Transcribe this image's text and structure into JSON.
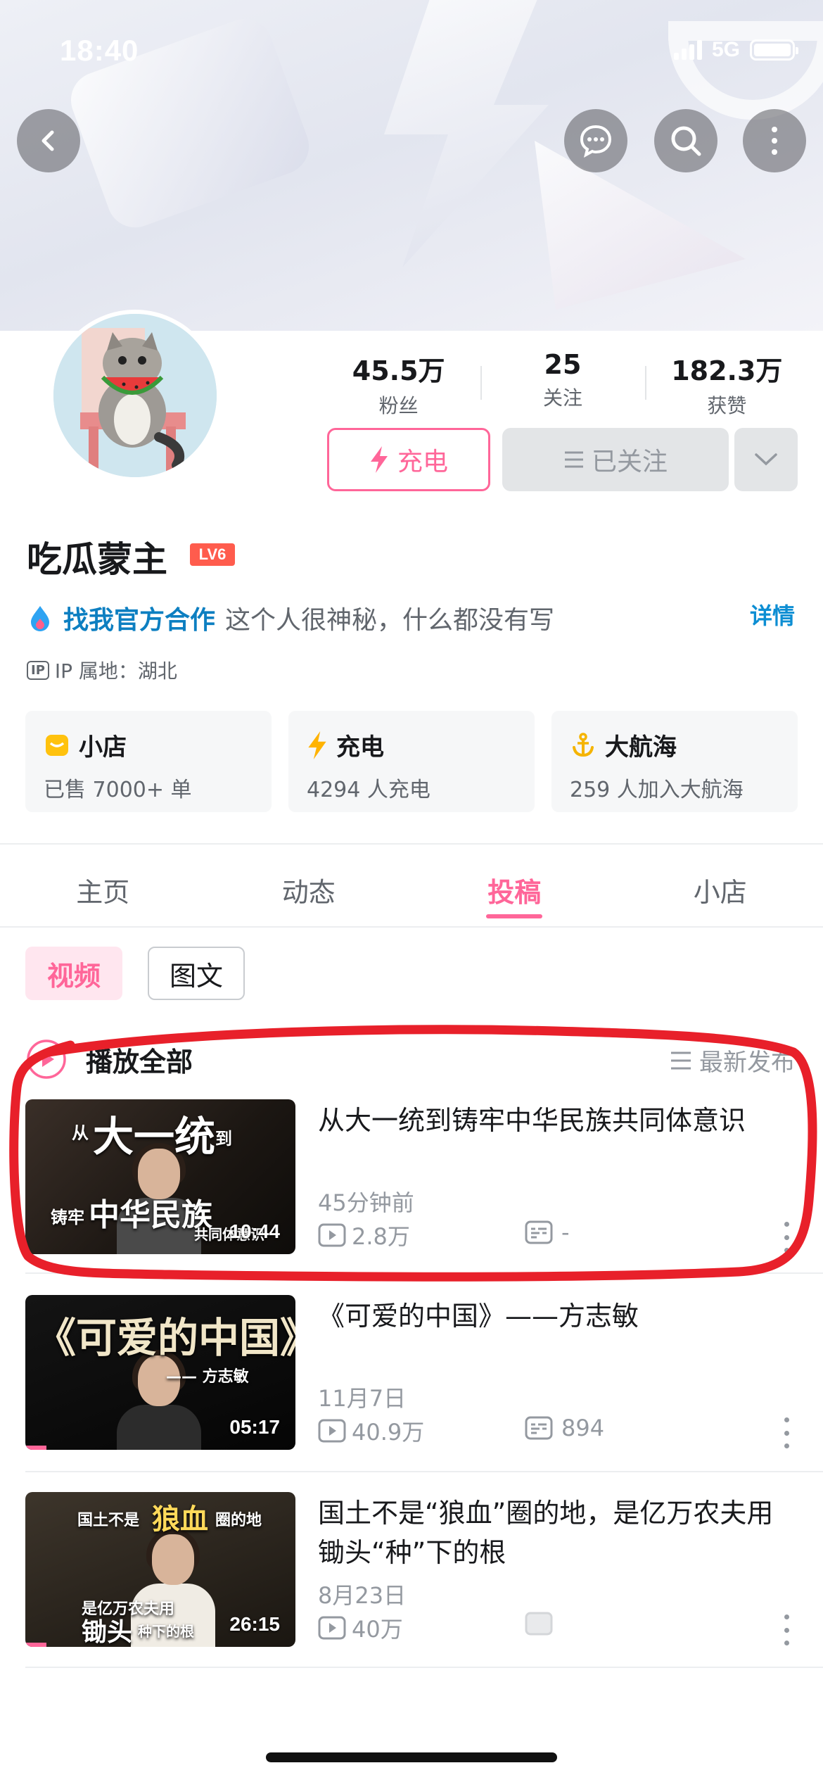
{
  "status_bar": {
    "time": "18:40",
    "network": "5G"
  },
  "header": {
    "back_icon": "back-icon",
    "message_icon": "message-icon",
    "search_icon": "search-icon",
    "more_icon": "more-vertical-icon"
  },
  "profile": {
    "stats": [
      {
        "value": "45.5万",
        "label": "粉丝"
      },
      {
        "value": "25",
        "label": "关注"
      },
      {
        "value": "182.3万",
        "label": "获赞"
      }
    ],
    "charge_button": "充电",
    "followed_button": "已关注",
    "name": "吃瓜蒙主",
    "level": "LV6",
    "official_link": "找我官方合作",
    "signature": "这个人很神秘，什么都没有写",
    "detail_link": "详情",
    "ip_badge": "IP",
    "ip_location": "IP 属地：湖北"
  },
  "cards": [
    {
      "title": "小店",
      "subtitle": "已售 7000+ 单",
      "icon": "shop-icon"
    },
    {
      "title": "充电",
      "subtitle": "4294 人充电",
      "icon": "lightning-icon"
    },
    {
      "title": "大航海",
      "subtitle": "259 人加入大航海",
      "icon": "anchor-icon"
    }
  ],
  "tabs": [
    {
      "label": "主页",
      "active": false
    },
    {
      "label": "动态",
      "active": false
    },
    {
      "label": "投稿",
      "active": true
    },
    {
      "label": "小店",
      "active": false
    }
  ],
  "filters": {
    "video": "视频",
    "article": "图文"
  },
  "list_header": {
    "play_all": "播放全部",
    "sort": "最新发布"
  },
  "videos": [
    {
      "title": "从大一统到铸牢中华民族共同体意识",
      "date": "45分钟前",
      "plays": "2.8万",
      "danmaku": "-",
      "duration": "10:44",
      "thumb_text": [
        "从",
        "大一统",
        "到",
        "铸牢",
        "中华民族",
        "共同体意识"
      ]
    },
    {
      "title": "《可爱的中国》——方志敏",
      "date": "11月7日",
      "plays": "40.9万",
      "danmaku": "894",
      "duration": "05:17",
      "thumb_text": [
        "《可爱的中国》",
        "—— 方志敏"
      ]
    },
    {
      "title": "国土不是“狼血”圈的地，是亿万农夫用锄头“种”下的根",
      "date": "8月23日",
      "plays": "40万",
      "danmaku": "",
      "duration": "26:15",
      "thumb_text": [
        "国土不是",
        "狼血",
        "圈的地",
        "是亿万农夫用",
        "锄头",
        "种下的根"
      ]
    }
  ],
  "colors": {
    "accent": "#ff6699",
    "official": "#0d7fc1",
    "annotation": "#e8202a"
  }
}
